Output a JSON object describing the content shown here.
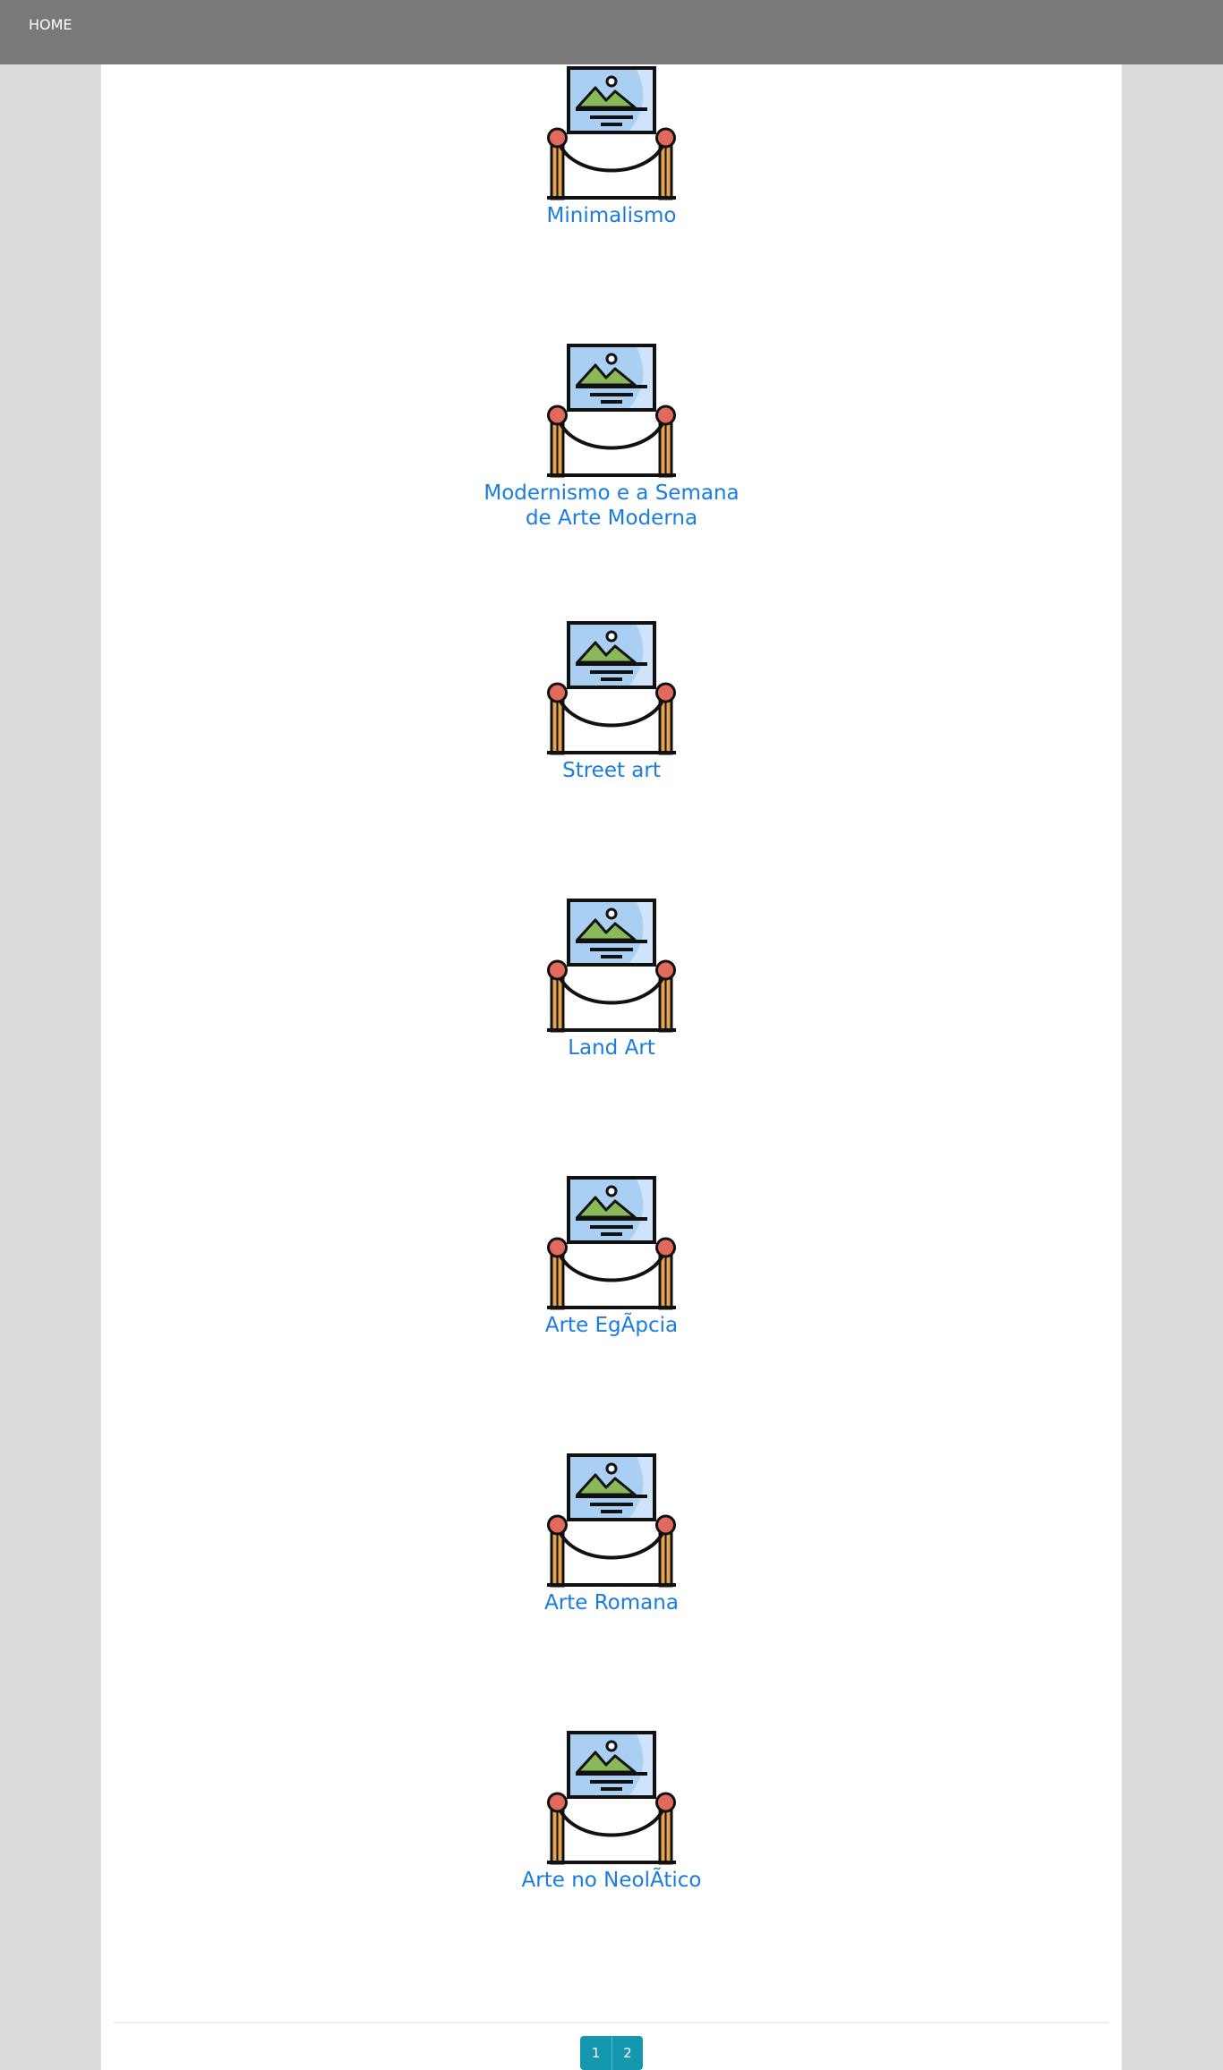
{
  "nav": {
    "home_label": "HOME"
  },
  "gallery": {
    "items": [
      {
        "title": "Minimalismo",
        "icon": "art-gallery-painting-icon"
      },
      {
        "title": "Modernismo e a Semana de Arte Moderna",
        "icon": "art-gallery-painting-icon"
      },
      {
        "title": "Street art",
        "icon": "art-gallery-painting-icon"
      },
      {
        "title": "Land Art",
        "icon": "art-gallery-painting-icon"
      },
      {
        "title": "Arte EgÃpcia",
        "icon": "art-gallery-painting-icon"
      },
      {
        "title": "Arte Romana",
        "icon": "art-gallery-painting-icon"
      },
      {
        "title": "Arte no NeolÃtico",
        "icon": "art-gallery-painting-icon"
      }
    ]
  },
  "pagination": {
    "pages": [
      "1",
      "2"
    ]
  },
  "colors": {
    "topbar": "#797979",
    "background": "#dcdcdc",
    "link": "#1a7be0",
    "pagination": "#1597b0"
  }
}
